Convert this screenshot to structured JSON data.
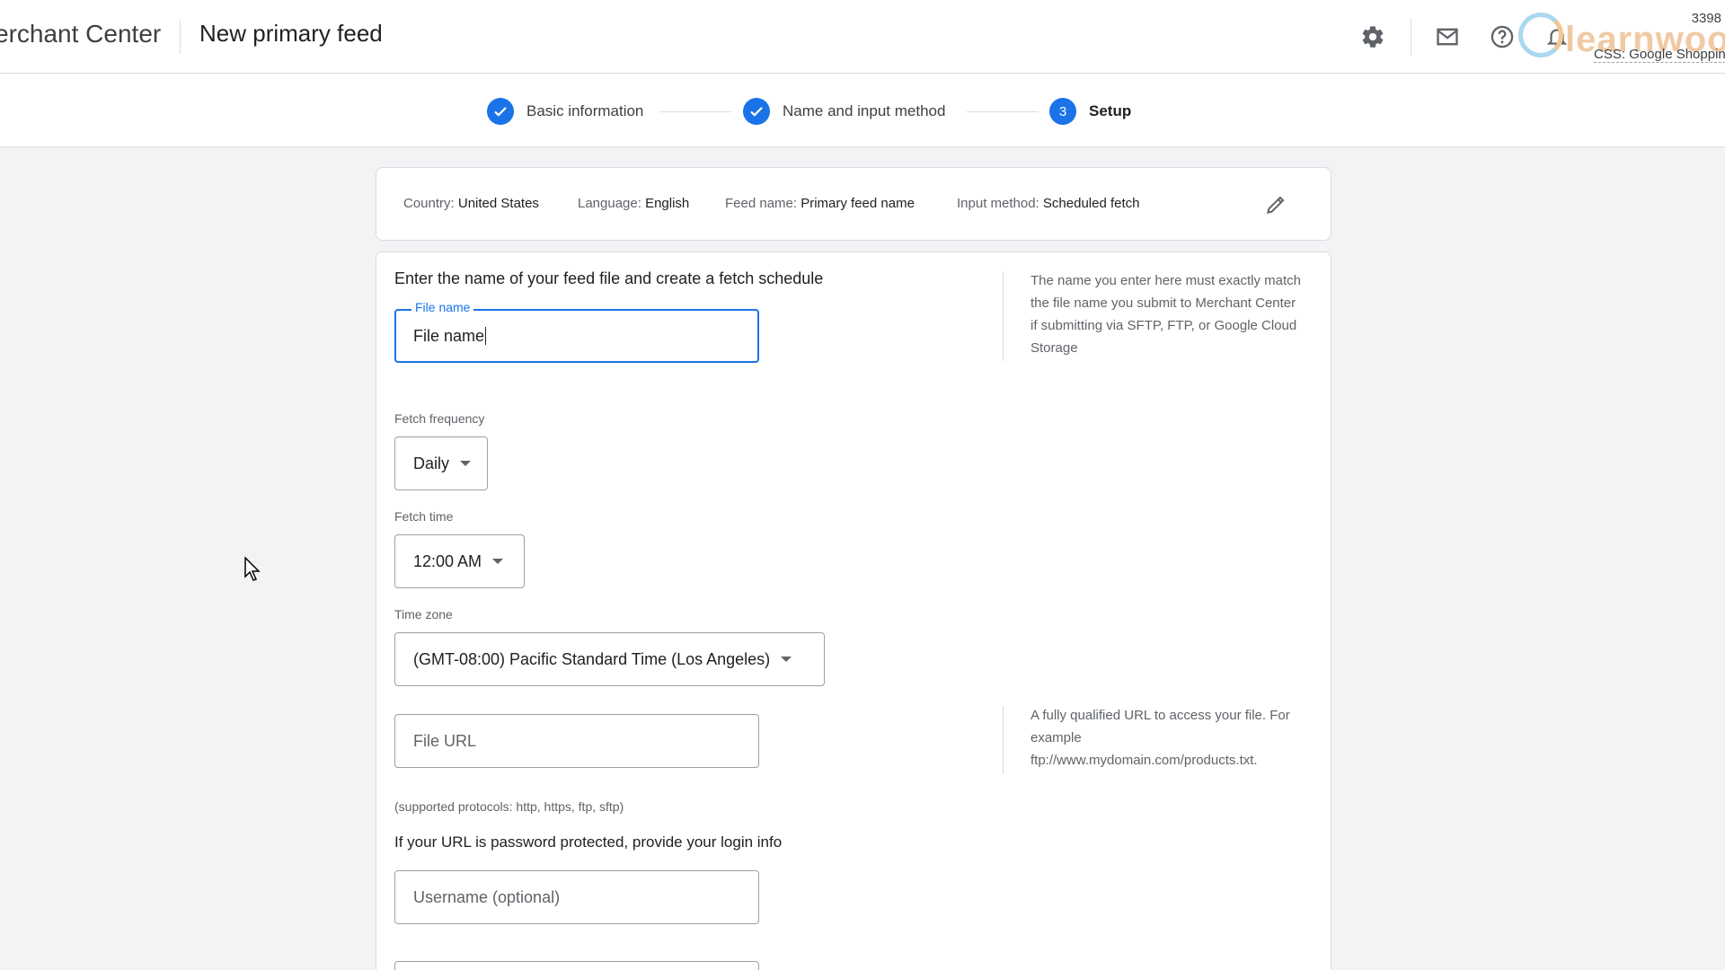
{
  "header": {
    "app_title": "erchant Center",
    "page_title": "New primary feed",
    "icons": [
      "gear-icon",
      "mail-icon",
      "help-icon",
      "bell-icon"
    ]
  },
  "watermark": {
    "number": "3398",
    "logo": "learnwoo",
    "caption": "CSS: Google Shoppin"
  },
  "stepper": {
    "steps": [
      {
        "label": "Basic information",
        "state": "done"
      },
      {
        "label": "Name and input method",
        "state": "done"
      },
      {
        "label": "Setup",
        "state": "current",
        "number": "3"
      }
    ]
  },
  "summary": {
    "country_key": "Country:",
    "country_val": "United States",
    "language_key": "Language:",
    "language_val": "English",
    "feed_name_key": "Feed name:",
    "feed_name_val": "Primary feed name",
    "input_method_key": "Input method:",
    "input_method_val": "Scheduled fetch"
  },
  "form": {
    "heading": "Enter the name of your feed file and create a fetch schedule",
    "file_name_label": "File name",
    "file_name_value": "File name",
    "file_name_help": "The name you enter here must exactly match the file name you submit to Merchant Center if submitting via SFTP, FTP, or Google Cloud Storage",
    "fetch_frequency_label": "Fetch frequency",
    "fetch_frequency_value": "Daily",
    "fetch_time_label": "Fetch time",
    "fetch_time_value": "12:00 AM",
    "time_zone_label": "Time zone",
    "time_zone_value": "(GMT-08:00) Pacific Standard Time (Los Angeles)",
    "file_url_placeholder": "File URL",
    "file_url_help": "A fully qualified URL to access your file. For example ftp://www.mydomain.com/products.txt.",
    "protocols": "(supported protocols: http, https, ftp, sftp)",
    "login_prompt": "If your URL is password protected, provide your login info",
    "username_placeholder": "Username (optional)"
  },
  "colors": {
    "accent": "#1a73e8",
    "background": "#f1f3f4",
    "border": "#dadce0"
  }
}
